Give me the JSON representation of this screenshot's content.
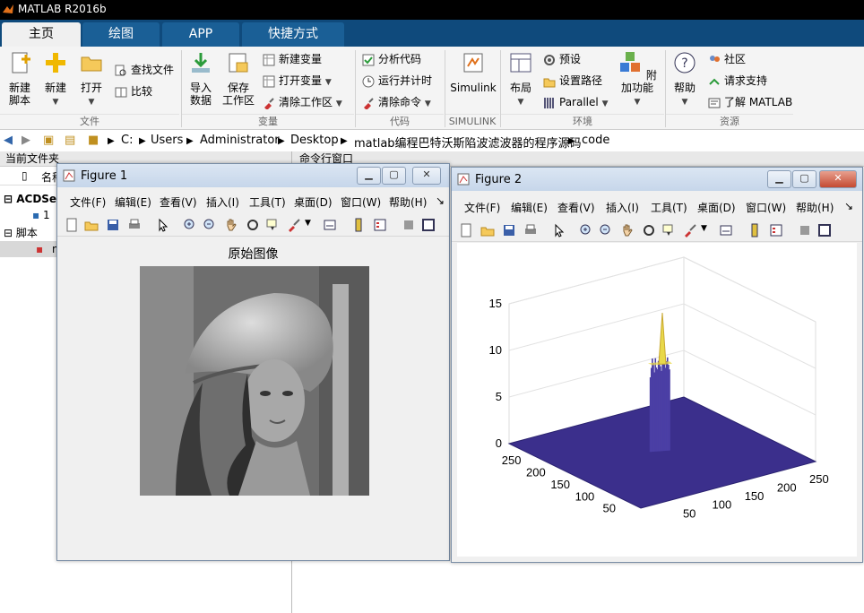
{
  "app": {
    "title": "MATLAB R2016b"
  },
  "tabs": [
    {
      "label": "主页",
      "active": true
    },
    {
      "label": "绘图",
      "active": false
    },
    {
      "label": "APP",
      "active": false
    },
    {
      "label": "快捷方式",
      "active": false
    }
  ],
  "ribbon": {
    "new_script": "新建\n脚本",
    "new": "新建",
    "open": "打开",
    "find_files": "查找文件",
    "compare": "比较",
    "import_data": "导入\n数据",
    "save_workspace": "保存\n工作区",
    "new_variable": "新建变量",
    "open_variable": "打开变量",
    "clear_workspace": "清除工作区",
    "analyze_code": "分析代码",
    "run_time": "运行并计时",
    "clear_commands": "清除命令",
    "simulink": "Simulink",
    "layout": "布局",
    "preferences": "预设",
    "set_path": "设置路径",
    "parallel": "Parallel",
    "addons": "附加功能",
    "help": "帮助",
    "community": "社区",
    "request_support": "请求支持",
    "learn_matlab": "了解 MATLAB",
    "groups": {
      "file": "文件",
      "variable": "变量",
      "code": "代码",
      "simulink": "SIMULINK",
      "environment": "环境",
      "resources": "资源"
    }
  },
  "address": {
    "segments": [
      "C:",
      "Users",
      "Administrator",
      "Desktop",
      "matlab编程巴特沃斯陷波滤波器的程序源码",
      "code"
    ]
  },
  "current_folder": {
    "title": "当前文件夹",
    "column": "名称",
    "items": [
      "ACDSee",
      "1",
      "脚本",
      "m"
    ]
  },
  "command_window": {
    "title": "命令行窗口"
  },
  "figure1": {
    "title": "Figure 1",
    "menu": [
      "文件(F)",
      "编辑(E)",
      "查看(V)",
      "插入(I)",
      "工具(T)",
      "桌面(D)",
      "窗口(W)",
      "帮助(H)"
    ],
    "plot_title": "原始图像"
  },
  "figure2": {
    "title": "Figure 2",
    "menu": [
      "文件(F)",
      "编辑(E)",
      "查看(V)",
      "插入(I)",
      "工具(T)",
      "桌面(D)",
      "窗口(W)",
      "帮助(H)"
    ]
  },
  "chart_data": {
    "type": "surface",
    "z_ticks": [
      "0",
      "5",
      "10",
      "15"
    ],
    "x_ticks": [
      "50",
      "100",
      "150",
      "200",
      "250"
    ],
    "y_ticks": [
      "50",
      "100",
      "150",
      "200",
      "250"
    ],
    "zlim": [
      0,
      15
    ],
    "xlim": [
      0,
      256
    ],
    "ylim": [
      0,
      256
    ],
    "peak_value": 15,
    "grid": true,
    "colors": {
      "base": "#3b2f8c",
      "peak": "#e8d84a"
    }
  },
  "colors": {
    "tab_bar": "#0f4a7c",
    "tab_inactive": "#1a5f96",
    "window_frame": "#7a8ea6"
  }
}
